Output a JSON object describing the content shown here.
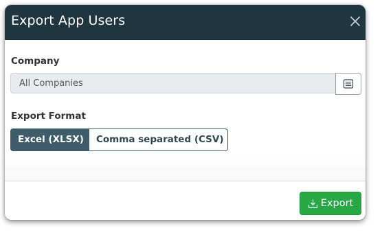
{
  "modal": {
    "title": "Export App Users"
  },
  "company": {
    "label": "Company",
    "value": "All Companies",
    "browse_icon": "list-icon"
  },
  "export_format": {
    "label": "Export Format",
    "options": [
      {
        "label": "Excel (XLSX)",
        "selected": true
      },
      {
        "label": "Comma separated (CSV)",
        "selected": false
      }
    ]
  },
  "footer": {
    "export_label": "Export",
    "export_icon": "download-icon"
  },
  "colors": {
    "header_bg": "#1f3540",
    "segment_active": "#3e5c6a",
    "export_button": "#28a745"
  }
}
